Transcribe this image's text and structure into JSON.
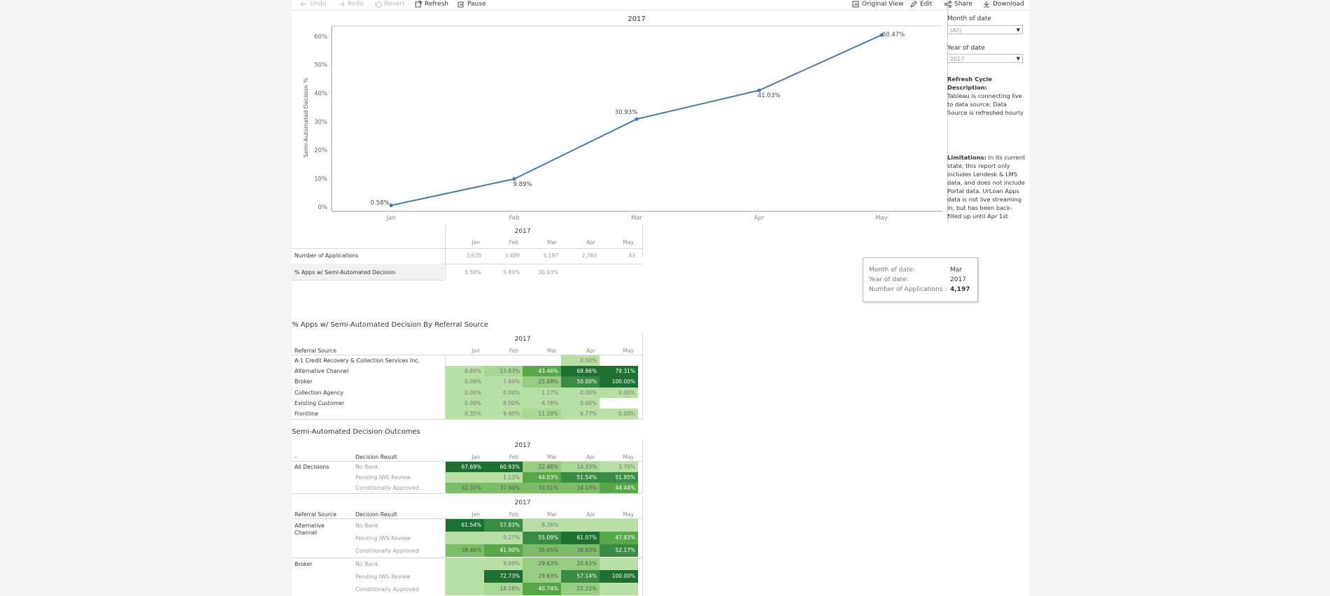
{
  "toolbar": {
    "undo": "Undo",
    "redo": "Redo",
    "revert": "Revert",
    "refresh": "Refresh",
    "pause": "Pause",
    "original_view": "Original View",
    "edit": "Edit",
    "share": "Share",
    "download": "Download"
  },
  "chart_data": {
    "type": "line",
    "title": "2017",
    "ylabel": "Semi-Automated Decision %",
    "categories": [
      "Jan",
      "Feb",
      "Mar",
      "Apr",
      "May"
    ],
    "values": [
      0.58,
      9.89,
      30.93,
      41.03,
      60.47
    ],
    "value_labels": [
      "0.58%",
      "9.89%",
      "30.93%",
      "41.03%",
      "60.47%"
    ],
    "yticks": [
      "0%",
      "10%",
      "20%",
      "30%",
      "40%",
      "50%",
      "60%"
    ],
    "ylim": [
      0,
      60
    ],
    "color": "#4e79a7"
  },
  "filters": {
    "month_label": "Month of date",
    "month_value": "(All)",
    "year_label": "Year of date",
    "year_value": "2017"
  },
  "notes": {
    "refresh_title": "Refresh Cycle Description:",
    "refresh_lines": [
      "Tableau is connecting live",
      "to data source; Data",
      "Source is refreshed hourly"
    ],
    "limitations_title": "Limitations:",
    "limitations_lines": [
      "In its current",
      "state, this report only",
      "includes Lendesk & LMS",
      "data, and does not include",
      "Portal data. UrLoan Apps",
      "data is not live streaming",
      "in, but has been back-",
      "filled up until Apr 1st"
    ]
  },
  "summary": {
    "year": "2017",
    "months": [
      "Jan",
      "Feb",
      "Mar",
      "Apr",
      "May"
    ],
    "rows": [
      {
        "label": "Number of Applications",
        "values": [
          "3,635",
          "3,489",
          "4,197",
          "2,783",
          "43"
        ]
      },
      {
        "label": "% Apps w/ Semi-Automated Decision",
        "values": [
          "0.58%",
          "9.89%",
          "30.93%",
          "",
          ""
        ]
      }
    ]
  },
  "tooltip": {
    "k1": "Month of date:",
    "v1": "Mar",
    "k2": "Year of date:",
    "v2": "2017",
    "k3": "Number of Applications :",
    "v3": "4,197"
  },
  "referral": {
    "title": "% Apps w/ Semi-Automated Decision By Referral Source",
    "year": "2017",
    "header": "Referral Source",
    "months": [
      "Jan",
      "Feb",
      "Mar",
      "Apr",
      "May"
    ],
    "rows": [
      {
        "label": "A-1 Credit Recovery & Collection Services Inc.",
        "values": [
          "",
          "",
          "",
          "0.00%",
          ""
        ]
      },
      {
        "label": "Alternative Channel",
        "values": [
          "0.89%",
          "13.83%",
          "43.46%",
          "68.86%",
          "79.31%"
        ]
      },
      {
        "label": "Broker",
        "values": [
          "0.00%",
          "7.69%",
          "25.68%",
          "50.00%",
          "100.00%"
        ]
      },
      {
        "label": "Collection Agency",
        "values": [
          "0.00%",
          "0.00%",
          "1.17%",
          "0.00%",
          "0.00%"
        ]
      },
      {
        "label": "Existing Customer",
        "values": [
          "0.00%",
          "0.00%",
          "4.78%",
          "0.00%",
          ""
        ]
      },
      {
        "label": "Frontline",
        "values": [
          "0.35%",
          "9.40%",
          "11.20%",
          "6.77%",
          "0.00%"
        ]
      }
    ]
  },
  "outcomes": {
    "title": "Semi-Automated Decision Outcomes",
    "year": "2017",
    "col1": "-",
    "col2": "Decision Result",
    "months": [
      "Jan",
      "Feb",
      "Mar",
      "Apr",
      "May"
    ],
    "group": "All Decisions",
    "rows": [
      {
        "label": "No Bank",
        "values": [
          "67.69%",
          "60.93%",
          "22.46%",
          "14.33%",
          "3.70%"
        ]
      },
      {
        "label": "Pending IWS Review",
        "values": [
          "",
          "1.13%",
          "44.03%",
          "51.54%",
          "51.85%"
        ]
      },
      {
        "label": "Conditionally Approved",
        "values": [
          "32.31%",
          "37.94%",
          "33.51%",
          "34.13%",
          "44.44%"
        ]
      }
    ]
  },
  "outcomes2": {
    "year": "2017",
    "col1": "Referral Source",
    "col2": "Decision Result",
    "months": [
      "Jan",
      "Feb",
      "Mar",
      "Apr",
      "May"
    ],
    "groups": [
      {
        "label_lines": [
          "Alternative",
          "Channel"
        ],
        "rows": [
          {
            "label": "No Bank",
            "values": [
              "61.54%",
              "57.83%",
              "8.26%",
              "",
              ""
            ]
          },
          {
            "label": "Pending IWS Review",
            "values": [
              "",
              "0.27%",
              "55.09%",
              "61.07%",
              "47.83%"
            ]
          },
          {
            "label": "Conditionally Approved",
            "values": [
              "38.46%",
              "41.90%",
              "36.65%",
              "38.93%",
              "52.17%"
            ]
          }
        ]
      },
      {
        "label_lines": [
          "Broker"
        ],
        "rows": [
          {
            "label": "No Bank",
            "values": [
              "",
              "9.09%",
              "29.63%",
              "20.63%",
              ""
            ]
          },
          {
            "label": "Pending IWS Review",
            "values": [
              "",
              "72.73%",
              "29.63%",
              "57.14%",
              "100.00%"
            ]
          },
          {
            "label": "Conditionally Approved",
            "values": [
              "",
              "18.18%",
              "40.74%",
              "22.22%",
              ""
            ]
          }
        ]
      }
    ]
  }
}
